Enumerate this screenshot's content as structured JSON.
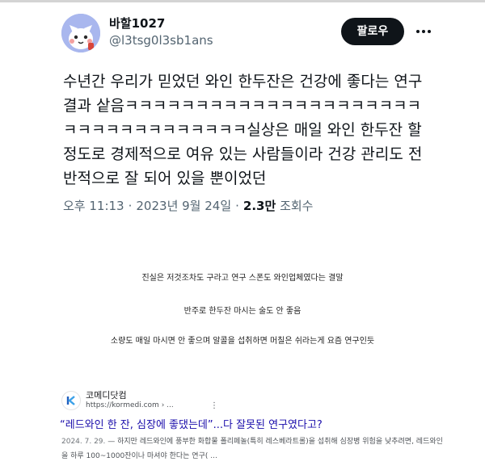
{
  "tweet": {
    "display_name": "바할1027",
    "handle": "@l3tsg0l3sb1ans",
    "follow_label": "팔로우",
    "more_icon": "more-horizontal-icon",
    "text": "수년간 우리가 믿었던 와인 한두잔은 건강에 좋다는 연구결과 샅음ㅋㅋㅋㅋㅋㅋㅋㅋㅋㅋㅋㅋㅋㅋㅋㅋㅋㅋㅋㅋㅋㅋㅋㅋㅋㅋㅋㅋㅋㅋㅋㅋㅋㅋ실상은 매일 와인 한두잔 할 정도로 경제적으로 여유 있는 사람들이라 건강 관리도 전반적으로 잘 되어 있을 뿐이었던",
    "time": "오후 11:13",
    "date": "2023년 9월 24일",
    "views_count": "2.3만",
    "views_label": "조회수",
    "separator": "·"
  },
  "body_lines": [
    "진실은 저것조차도 구라고 연구 스폰도 와인업체였다는 결말",
    "반주로 한두잔 마시는 술도 안 좋음",
    "소량도 매일 마시면 안 좋으며 알콜을 섭취하면 머칠은 쉬라는게 요즘 연구인듯"
  ],
  "search_result": {
    "site_name": "코메디닷컴",
    "site_url": "https://kormedi.com",
    "site_url_suffix": "› ...",
    "kebab": "⋮",
    "title": "“레드와인 한 잔, 심장에 좋댔는데”...다 잘못된 연구였다고?",
    "snippet_date": "2024. 7. 29.",
    "snippet_text": " — 하지만 레드와인에 풍부한 화합물 폴리페놀(특히 레스베라트롤)을 섭취해 심장병 위험을 낮추려면, 레드와인을 하루 100~1000잔이나 마셔야 한다는 연구( ..."
  },
  "colors": {
    "link": "#1a0dab",
    "muted": "#536471",
    "text": "#0f1419",
    "button_bg": "#0f1419"
  }
}
